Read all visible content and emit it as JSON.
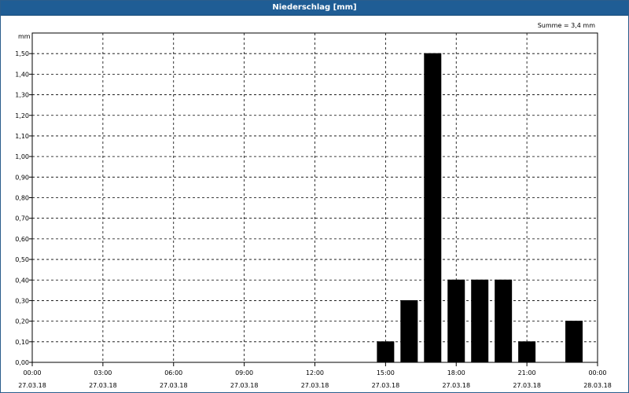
{
  "window": {
    "title": "Niederschlag [mm]"
  },
  "chart_data": {
    "type": "bar",
    "title": "Niederschlag [mm]",
    "ylabel": "mm",
    "summary": "Summe = 3,4 mm",
    "ylim": [
      0,
      1.6
    ],
    "yticks": [
      "0,00",
      "0,10",
      "0,20",
      "0,30",
      "0,40",
      "0,50",
      "0,60",
      "0,70",
      "0,80",
      "0,90",
      "1,00",
      "1,10",
      "1,20",
      "1,30",
      "1,40",
      "1,50"
    ],
    "xlim_hours": [
      0,
      24
    ],
    "xticks": [
      {
        "time": "00:00",
        "date": "27.03.18"
      },
      {
        "time": "03:00",
        "date": "27.03.18"
      },
      {
        "time": "06:00",
        "date": "27.03.18"
      },
      {
        "time": "09:00",
        "date": "27.03.18"
      },
      {
        "time": "12:00",
        "date": "27.03.18"
      },
      {
        "time": "15:00",
        "date": "27.03.18"
      },
      {
        "time": "18:00",
        "date": "27.03.18"
      },
      {
        "time": "21:00",
        "date": "27.03.18"
      },
      {
        "time": "00:00",
        "date": "28.03.18"
      }
    ],
    "grid": true,
    "bar_color": "#000000",
    "series": [
      {
        "x": [
          "27.03.18 15:00",
          "27.03.18 16:00",
          "27.03.18 17:00",
          "27.03.18 18:00",
          "27.03.18 19:00",
          "27.03.18 20:00",
          "27.03.18 21:00",
          "27.03.18 22:00",
          "27.03.18 23:00"
        ],
        "values": [
          0.1,
          0.3,
          1.5,
          0.4,
          0.4,
          0.4,
          0.1,
          0.0,
          0.2
        ]
      }
    ]
  }
}
